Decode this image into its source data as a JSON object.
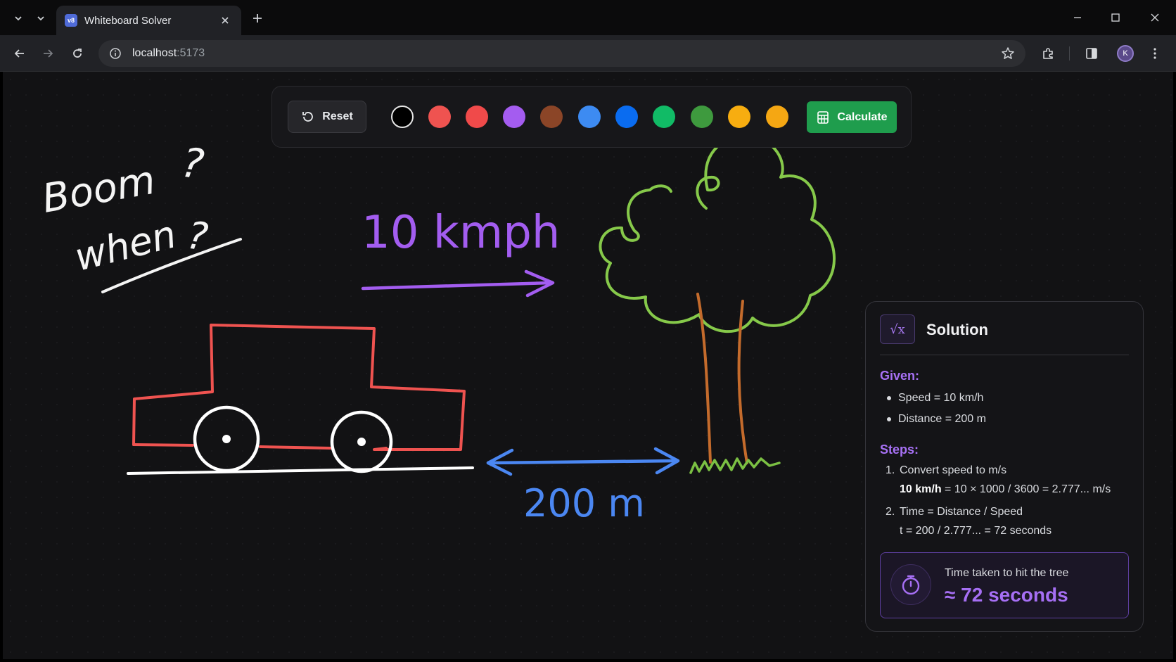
{
  "browser": {
    "tab_title": "Whiteboard Solver",
    "favicon_label": "v8",
    "url_host": "localhost",
    "url_port": ":5173",
    "profile_initial": "K"
  },
  "toolbar": {
    "reset_label": "Reset",
    "calculate_label": "Calculate",
    "swatches": [
      {
        "name": "black",
        "color": "#000000"
      },
      {
        "name": "red",
        "color": "#ef5350"
      },
      {
        "name": "light-red",
        "color": "#f04a4a"
      },
      {
        "name": "purple",
        "color": "#a45cf0"
      },
      {
        "name": "brown",
        "color": "#8b4527"
      },
      {
        "name": "light-blue",
        "color": "#3d8bf2"
      },
      {
        "name": "blue",
        "color": "#0a6cf0"
      },
      {
        "name": "green",
        "color": "#11bb66"
      },
      {
        "name": "dark-green",
        "color": "#3e9a3e"
      },
      {
        "name": "amber",
        "color": "#f7ad10"
      },
      {
        "name": "orange",
        "color": "#f5a713"
      }
    ]
  },
  "canvas": {
    "note_line1": "Boom",
    "note_line2": "when",
    "q1": "?",
    "q2": "?",
    "speed_label": "10 kmph",
    "distance_label": "200 m",
    "colors": {
      "note": "#f4f4f4",
      "speed": "#a35df0",
      "car": "#ef5350",
      "wheels": "#ffffff",
      "distance": "#4b87f2",
      "tree_leaves": "#86c94a",
      "tree_trunk": "#c46b2c",
      "grass": "#7bc043"
    }
  },
  "solution": {
    "title": "Solution",
    "icon": "√x",
    "given_label": "Given:",
    "given": [
      "Speed = 10 km/h",
      "Distance = 200 m"
    ],
    "steps_label": "Steps:",
    "steps": [
      {
        "num": "1.",
        "title": "Convert speed to m/s",
        "detail_bold": "10 km/h",
        "detail": " = 10 × 1000 / 3600 = 2.777... m/s"
      },
      {
        "num": "2.",
        "title": "Time = Distance / Speed",
        "detail_bold": "",
        "detail": "t = 200 / 2.777... = 72 seconds"
      }
    ],
    "answer_caption": "Time taken to hit the tree",
    "answer_value": "≈ 72 seconds"
  }
}
